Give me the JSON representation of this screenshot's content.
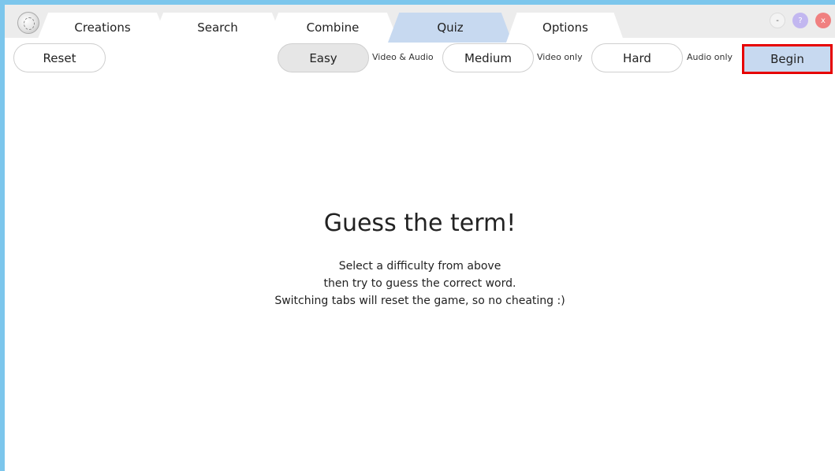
{
  "tabs": [
    {
      "label": "Creations",
      "active": false
    },
    {
      "label": "Search",
      "active": false
    },
    {
      "label": "Combine",
      "active": false
    },
    {
      "label": "Quiz",
      "active": true
    },
    {
      "label": "Options",
      "active": false
    }
  ],
  "window": {
    "minimize": "-",
    "help": "?",
    "close": "x"
  },
  "toolbar": {
    "reset": "Reset",
    "easy": "Easy",
    "easy_desc": "Video & Audio",
    "medium": "Medium",
    "medium_desc": "Video only",
    "hard": "Hard",
    "hard_desc": "Audio only",
    "begin": "Begin",
    "selected": "Easy"
  },
  "main": {
    "heading": "Guess the term!",
    "lines": [
      "Select a difficulty from above",
      "then try to guess the correct word.",
      "Switching tabs will reset the game, so no cheating :)"
    ]
  },
  "colors": {
    "active_tab": "#c7d9f0",
    "window_border": "#7cc6ec",
    "begin_highlight": "#e60000"
  }
}
